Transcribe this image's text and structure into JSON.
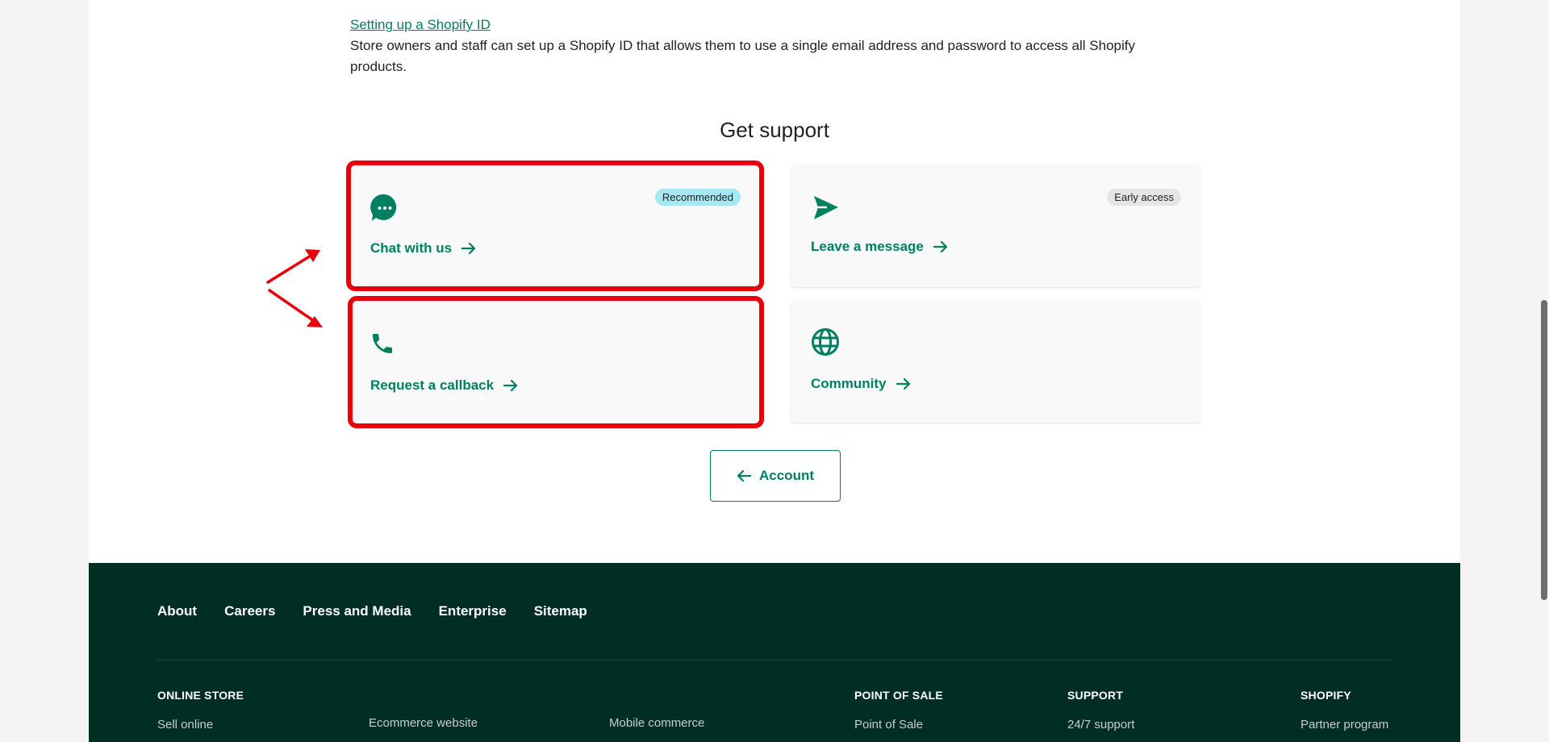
{
  "article": {
    "link_text": "Setting up a Shopify ID",
    "description": "Store owners and staff can set up a Shopify ID that allows them to use a single email address and password to access all Shopify products."
  },
  "support": {
    "title": "Get support",
    "cards": [
      {
        "label": "Chat with us",
        "badge": "Recommended",
        "icon": "chat-bubble-icon"
      },
      {
        "label": "Leave a message",
        "badge": "Early access",
        "icon": "send-icon"
      },
      {
        "label": "Request a callback",
        "icon": "phone-icon"
      },
      {
        "label": "Community",
        "icon": "globe-icon"
      }
    ],
    "back_button": "Account"
  },
  "footer": {
    "nav": [
      "About",
      "Careers",
      "Press and Media",
      "Enterprise",
      "Sitemap"
    ],
    "columns": {
      "online_store": {
        "heading": "ONLINE STORE",
        "items": [
          "Sell online",
          "Ecommerce website",
          "Mobile commerce"
        ]
      },
      "pos": {
        "heading": "POINT OF SALE",
        "items": [
          "Point of Sale"
        ]
      },
      "support": {
        "heading": "SUPPORT",
        "items": [
          "24/7 support"
        ]
      },
      "shopify": {
        "heading": "SHOPIFY",
        "items": [
          "Partner program"
        ]
      }
    }
  },
  "colors": {
    "accent": "#008060",
    "footer_bg": "#002e25",
    "highlight": "#e8000b",
    "recommended_badge": "#a4e8f2"
  }
}
